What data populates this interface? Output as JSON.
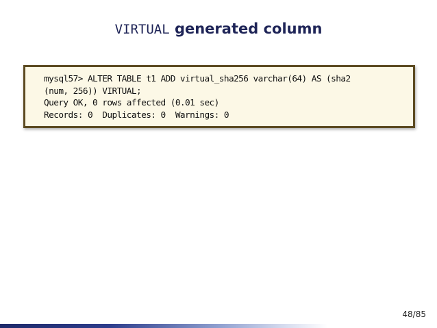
{
  "slide": {
    "title_code": "VIRTUAL",
    "title_text": " generated column",
    "code_lines": [
      "mysql57> ALTER TABLE t1 ADD virtual_sha256 varchar(64) AS (sha2",
      "(num, 256)) VIRTUAL;",
      "Query OK, 0 rows affected (0.01 sec)",
      "Records: 0  Duplicates: 0  Warnings: 0"
    ],
    "page_number": "48/85"
  },
  "colors": {
    "title": "#1e2457",
    "code_background": "#fcf8e6",
    "code_border": "#5c4a21",
    "footer_bar": "#2d3d8c"
  }
}
